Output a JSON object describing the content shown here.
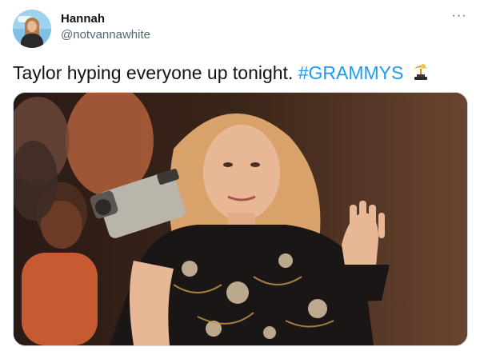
{
  "user": {
    "display_name": "Hannah",
    "handle": "@notvannawhite"
  },
  "menu": {
    "more_label": "···",
    "icon": "more-horizontal-icon"
  },
  "tweet": {
    "text": "Taylor hyping everyone up tonight. ",
    "hashtag": "#GRAMMYS",
    "hashtag_emoji_icon": "grammy-trophy-icon"
  },
  "media": {
    "type": "photo",
    "icon": "photo"
  },
  "colors": {
    "link": "#1d9bf0",
    "secondary_text": "#536471",
    "primary_text": "#0f1419",
    "border": "#cfd9de"
  }
}
